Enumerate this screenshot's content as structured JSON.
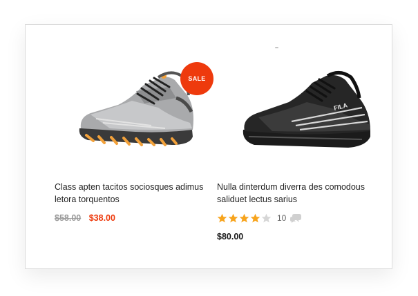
{
  "products": [
    {
      "image_icon": "running-shoe-gray-orange",
      "badge": "SALE",
      "title": "Class apten tacitos sociosques adimus letora torquentos",
      "old_price": "$58.00",
      "price": "$38.00"
    },
    {
      "image_icon": "running-shoe-black-fila",
      "title": "Nulla dinterdum diverra des comodous saliduet lectus sarius",
      "rating": 4,
      "rating_max": 5,
      "review_count": "10",
      "price": "$80.00"
    }
  ],
  "colors": {
    "accent": "#ee3a0d",
    "star": "#f7a41d",
    "star_empty": "#d6d6d6",
    "comment_icon": "#d0d0d0"
  }
}
